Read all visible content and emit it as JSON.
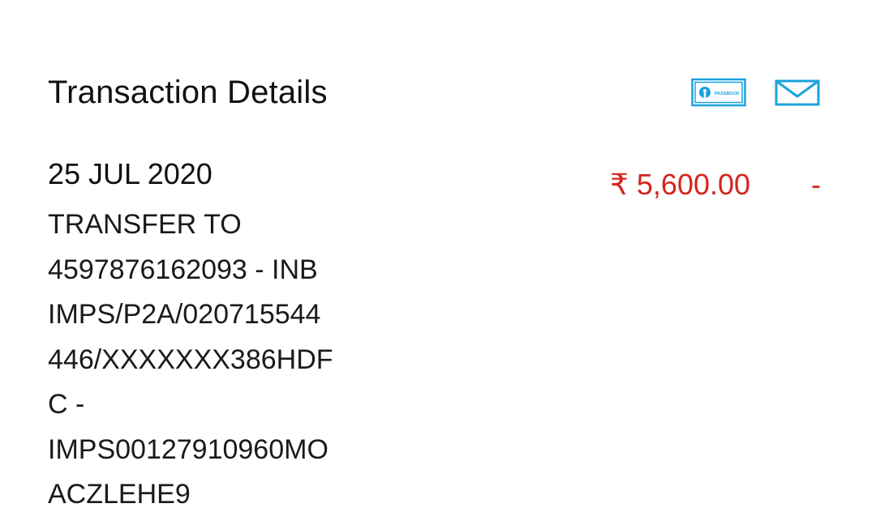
{
  "header": {
    "title": "Transaction Details",
    "passbook_icon": "passbook-icon",
    "passbook_icon_text": "PASSBOOK",
    "mail_icon": "mail-icon",
    "icon_color": "#1aa3dc"
  },
  "transaction": {
    "date": "25 JUL 2020",
    "description_lines": [
      "TRANSFER TO",
      "4597876162093 - INB",
      "IMPS/P2A/020715544",
      "446/XXXXXXX386HDF",
      "C -",
      "IMPS00127910960MO",
      "ACZLEHE9"
    ],
    "amount": "₹ 5,600.00",
    "type_indicator": "-",
    "amount_color": "#d4251c"
  }
}
